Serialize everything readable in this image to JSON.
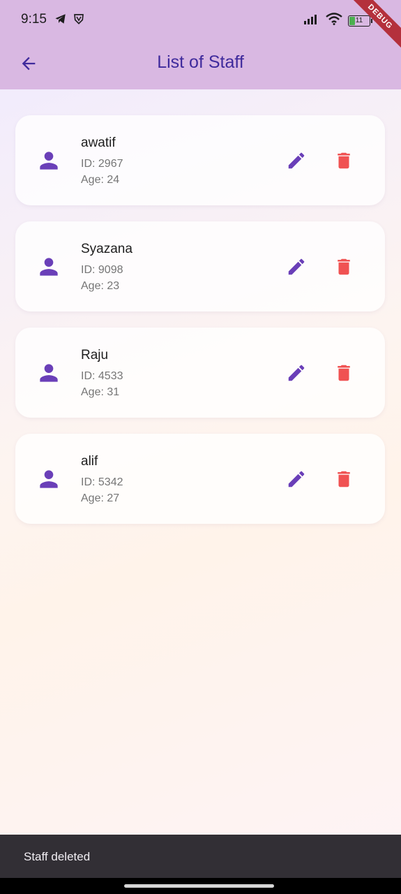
{
  "status_bar": {
    "time": "9:15",
    "left_icons": [
      "telegram-icon",
      "shield-icon"
    ],
    "right_icons": [
      "signal-icon",
      "wifi-icon",
      "battery-icon"
    ],
    "battery_level": "11"
  },
  "debug_banner": "DEBUG",
  "app_bar": {
    "title": "List of Staff",
    "back_icon": "arrow-left-icon",
    "background_color": "#d9b8e2",
    "title_color": "#3f2a9c"
  },
  "staff": [
    {
      "name": "awatif",
      "id": "ID: 2967",
      "age": "Age: 24"
    },
    {
      "name": "Syazana",
      "id": "ID: 9098",
      "age": "Age: 23"
    },
    {
      "name": "Raju",
      "id": "ID: 4533",
      "age": "Age: 31"
    },
    {
      "name": "alif",
      "id": "ID: 5342",
      "age": "Age: 27"
    }
  ],
  "colors": {
    "person_icon": "#6a3fb8",
    "edit_icon": "#6a3fb8",
    "delete_icon": "#f05252"
  },
  "snackbar": {
    "message": "Staff deleted"
  }
}
